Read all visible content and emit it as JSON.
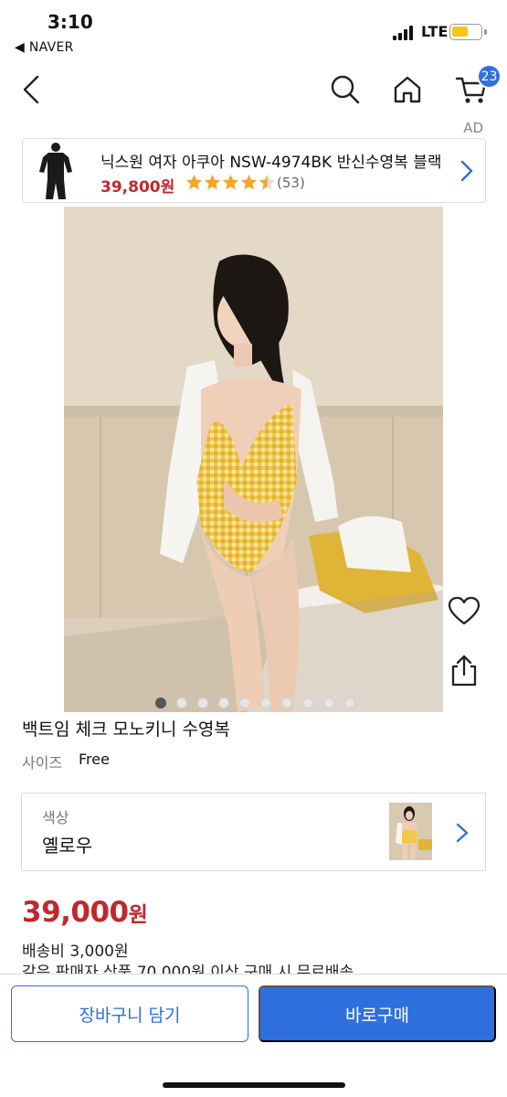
{
  "status_bar": {
    "time": "3:10",
    "back_app": "◀ NAVER",
    "network": "LTE",
    "battery_level": 0.6,
    "battery_color": "#f5c518"
  },
  "nav": {
    "icons": [
      "back-arrow-icon",
      "search-icon",
      "home-icon",
      "cart-icon"
    ],
    "cart_count": "23"
  },
  "ad": {
    "label": "AD",
    "title": "닉스원 여자 아쿠아 NSW-4974BK 반신수영복 블랙",
    "price": "39,800원",
    "rating": 4.5,
    "review_count": "(53)"
  },
  "gallery": {
    "image_count": 10,
    "active_index": 0,
    "actions": [
      "heart-icon",
      "share-icon"
    ]
  },
  "product": {
    "name": "백트임 체크 모노키니 수영복",
    "size_label": "사이즈",
    "size_value": "Free",
    "color_label": "색상",
    "color_value": "옐로우",
    "price_number": "39,000",
    "price_unit": "원",
    "shipping": "배송비 3,000원",
    "free_shipping": "같은 판매자 상품 70,000원 이상 구매 시 무료배송"
  },
  "actions": {
    "cart_button": "장바구니 담기",
    "buy_button": "바로구매"
  },
  "colors": {
    "accent": "#2f6fde",
    "price": "#c1272d",
    "star": "#f5a623"
  }
}
